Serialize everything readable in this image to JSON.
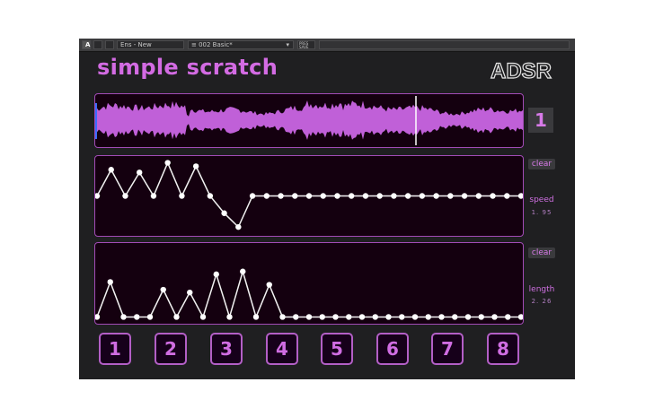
{
  "host": {
    "toolbar_btn_a": "A",
    "preset_slot": "Ens - New",
    "preset_name": "002  Basic*",
    "save_label": "PRES SAVE"
  },
  "app": {
    "title": "simple scratch",
    "logo_text": "ADSR"
  },
  "sample": {
    "active_slot": "1"
  },
  "speed": {
    "clear_label": "clear",
    "label": "speed",
    "value": "1. 95"
  },
  "length": {
    "clear_label": "clear",
    "label": "length",
    "value": "2. 26"
  },
  "slots": [
    "1",
    "2",
    "3",
    "4",
    "5",
    "6",
    "7",
    "8"
  ],
  "colors": {
    "accent": "#cf70e2",
    "waveform": "#c060d8",
    "panel_bg": "#14000f",
    "panel_border": "#a24bb6",
    "bg": "#1f1f21"
  },
  "speed_curve": [
    0.5,
    0.88,
    0.5,
    0.84,
    0.5,
    0.98,
    0.5,
    0.93,
    0.5,
    0.25,
    0.05,
    0.5,
    0.5,
    0.5,
    0.5,
    0.5,
    0.5,
    0.5,
    0.5,
    0.5,
    0.5,
    0.5,
    0.5,
    0.5,
    0.5,
    0.5,
    0.5,
    0.5,
    0.5,
    0.5,
    0.5
  ],
  "length_curve": [
    0.02,
    0.52,
    0.02,
    0.02,
    0.02,
    0.41,
    0.02,
    0.37,
    0.02,
    0.63,
    0.02,
    0.67,
    0.02,
    0.48,
    0.02,
    0.02,
    0.02,
    0.02,
    0.02,
    0.02,
    0.02,
    0.02,
    0.02,
    0.02,
    0.02,
    0.02,
    0.02,
    0.02,
    0.02,
    0.02,
    0.02,
    0.02,
    0.02
  ]
}
